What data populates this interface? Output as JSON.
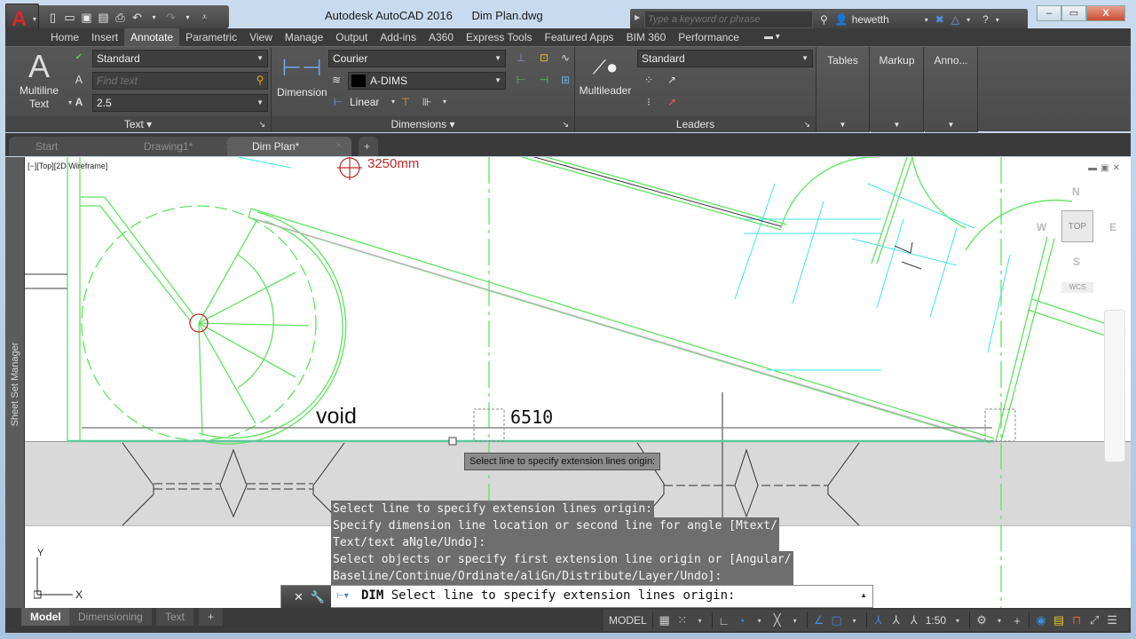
{
  "app": {
    "name": "Autodesk AutoCAD 2016",
    "file": "Dim Plan.dwg",
    "app_button_icon": "autocad-a-icon"
  },
  "quick_access": [
    "new-icon",
    "open-icon",
    "save-icon",
    "saveas-icon",
    "plot-icon",
    "undo-icon",
    "redo-icon",
    "customize-icon"
  ],
  "search": {
    "placeholder": "Type a keyword or phrase"
  },
  "user": {
    "name": "hewetth"
  },
  "window_controls": [
    "minimize",
    "restore",
    "close"
  ],
  "ribbon_tabs": [
    {
      "label": "Home",
      "active": false
    },
    {
      "label": "Insert",
      "active": false
    },
    {
      "label": "Annotate",
      "active": true
    },
    {
      "label": "Parametric",
      "active": false
    },
    {
      "label": "View",
      "active": false
    },
    {
      "label": "Manage",
      "active": false
    },
    {
      "label": "Output",
      "active": false
    },
    {
      "label": "Add-ins",
      "active": false
    },
    {
      "label": "A360",
      "active": false
    },
    {
      "label": "Express Tools",
      "active": false
    },
    {
      "label": "Featured Apps",
      "active": false
    },
    {
      "label": "BIM 360",
      "active": false
    },
    {
      "label": "Performance",
      "active": false
    }
  ],
  "ribbon": {
    "text_panel": {
      "big_button_line1": "Multiline",
      "big_button_line2": "Text",
      "style": "Standard",
      "find_placeholder": "Find text",
      "height": "2.5",
      "title": "Text"
    },
    "dimensions_panel": {
      "big_button": "Dimension",
      "style": "Courier",
      "layer": "A-DIMS",
      "layer_color": "#000000",
      "linear": "Linear",
      "title": "Dimensions"
    },
    "leaders_panel": {
      "big_button": "Multileader",
      "style": "Standard",
      "title": "Leaders"
    },
    "tables": "Tables",
    "markup": "Markup",
    "annotation_scaling": "Anno..."
  },
  "doc_tabs": [
    {
      "label": "Start",
      "active": false
    },
    {
      "label": "Drawing1*",
      "active": false
    },
    {
      "label": "Dim Plan*",
      "active": true
    }
  ],
  "viewport": {
    "label": "[−][Top][2D Wireframe]",
    "viewcube": {
      "n": "N",
      "s": "S",
      "e": "E",
      "w": "W",
      "face": "TOP",
      "wcs": "WCS"
    },
    "sheet_set_manager": "Sheet Set Manager",
    "drawing_text": {
      "void_label": "void",
      "dimension_value": "6510",
      "level_marker": "3250mm"
    },
    "tooltip": "Select line to specify extension lines origin:",
    "ucs": {
      "x": "X",
      "y": "Y"
    }
  },
  "command_history": [
    "Select line to specify extension lines origin:",
    "Specify dimension line location or second line for angle [Mtext/\nText/text aNgle/Undo]:",
    "Select objects or specify first extension line origin or [Angular/\nBaseline/Continue/Ordinate/aliGn/Distribute/Layer/Undo]:"
  ],
  "command_line": {
    "command": "DIM",
    "prompt": "Select line to specify extension lines origin:"
  },
  "layout_tabs": [
    {
      "label": "Model",
      "active": true
    },
    {
      "label": "Dimensioning",
      "active": false
    },
    {
      "label": "Text",
      "active": false
    }
  ],
  "status_bar": {
    "mode": "MODEL",
    "scale": "1:50"
  },
  "colors": {
    "ribbon_bg": "#4f4f4f",
    "drawing_green": "#5ee35e",
    "drawing_cyan": "#3fe6e6",
    "marker_red": "#c0282d"
  }
}
